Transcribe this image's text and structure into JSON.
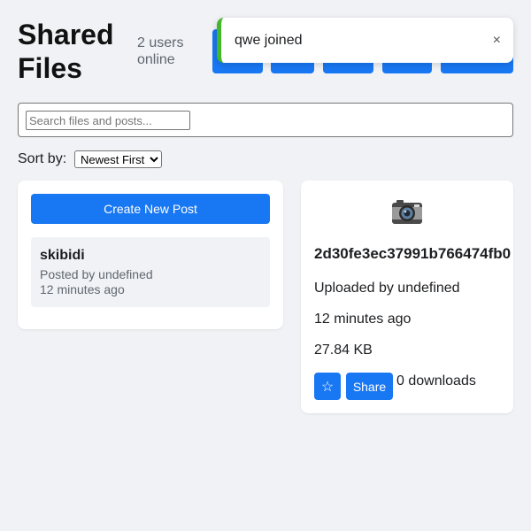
{
  "header": {
    "title": "Shared Files",
    "users_online": "2 users online"
  },
  "toolbar": {
    "button_count": 5,
    "color": "#1877f2"
  },
  "toast": {
    "message": "qwe joined",
    "close_label": "×",
    "accent_color": "#42b72a"
  },
  "search": {
    "placeholder": "Search files and posts...",
    "value": ""
  },
  "sort": {
    "label": "Sort by:",
    "selected": "Newest First"
  },
  "posts": {
    "create_label": "Create New Post",
    "items": [
      {
        "title": "skibidi",
        "author": "Posted by undefined",
        "time": "12 minutes ago"
      }
    ]
  },
  "file": {
    "icon": "camera-icon",
    "name": "2d30fe3ec37991b766474fb0",
    "uploader": "Uploaded by undefined",
    "time": "12 minutes ago",
    "size": "27.84 KB",
    "star_label": "☆",
    "share_label": "Share",
    "downloads": "0 downloads"
  }
}
